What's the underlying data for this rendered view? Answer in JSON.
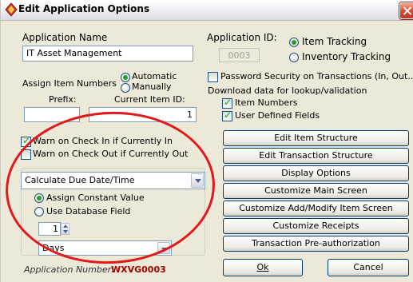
{
  "window": {
    "title": "Edit Application Options",
    "close_icon": "close-icon"
  },
  "app": {
    "name_label": "Application Name",
    "name_value": "IT Asset Management",
    "id_label": "Application ID:",
    "id_value": "0003",
    "tracking_options": [
      {
        "label": "Item Tracking",
        "selected": true
      },
      {
        "label": "Inventory Tracking",
        "selected": false
      }
    ]
  },
  "numbering": {
    "label": "Assign Item Numbers",
    "options": [
      {
        "label": "Automatic",
        "selected": true
      },
      {
        "label": "Manually",
        "selected": false
      }
    ],
    "prefix_label": "Prefix:",
    "prefix_value": "",
    "current_id_label": "Current Item ID:",
    "current_id_value": "1"
  },
  "security": {
    "label": "Password Security on Transactions (In, Out..)",
    "checked": false
  },
  "download": {
    "label": "Download data for lookup/validation",
    "items": [
      {
        "label": "Item Numbers",
        "checked": true
      },
      {
        "label": "User Defined Fields",
        "checked": true
      }
    ]
  },
  "warnings": [
    {
      "label": "Warn on Check In if Currently In",
      "checked": true
    },
    {
      "label": "Warn on Check Out if Currently Out",
      "checked": false
    }
  ],
  "due_date": {
    "select_value": "Calculate Due Date/Time",
    "options": [
      {
        "label": "Assign Constant Value",
        "selected": true
      },
      {
        "label": "Use Database Field",
        "selected": false
      }
    ],
    "amount": "1",
    "unit": "Days"
  },
  "buttons": [
    "Edit Item Structure",
    "Edit Transaction Structure",
    "Display Options",
    "Customize Main Screen",
    "Customize Add/Modify Item Screen",
    "Customize Receipts",
    "Transaction Pre-authorization"
  ],
  "footer": {
    "app_number_label": "Application Number:",
    "app_number_value": "WXVG0003",
    "ok_label": "Ok",
    "cancel_label": "Cancel"
  },
  "colors": {
    "highlight_circle": "#e2191b",
    "check_green": "#21a121",
    "app_number": "#a00000"
  }
}
